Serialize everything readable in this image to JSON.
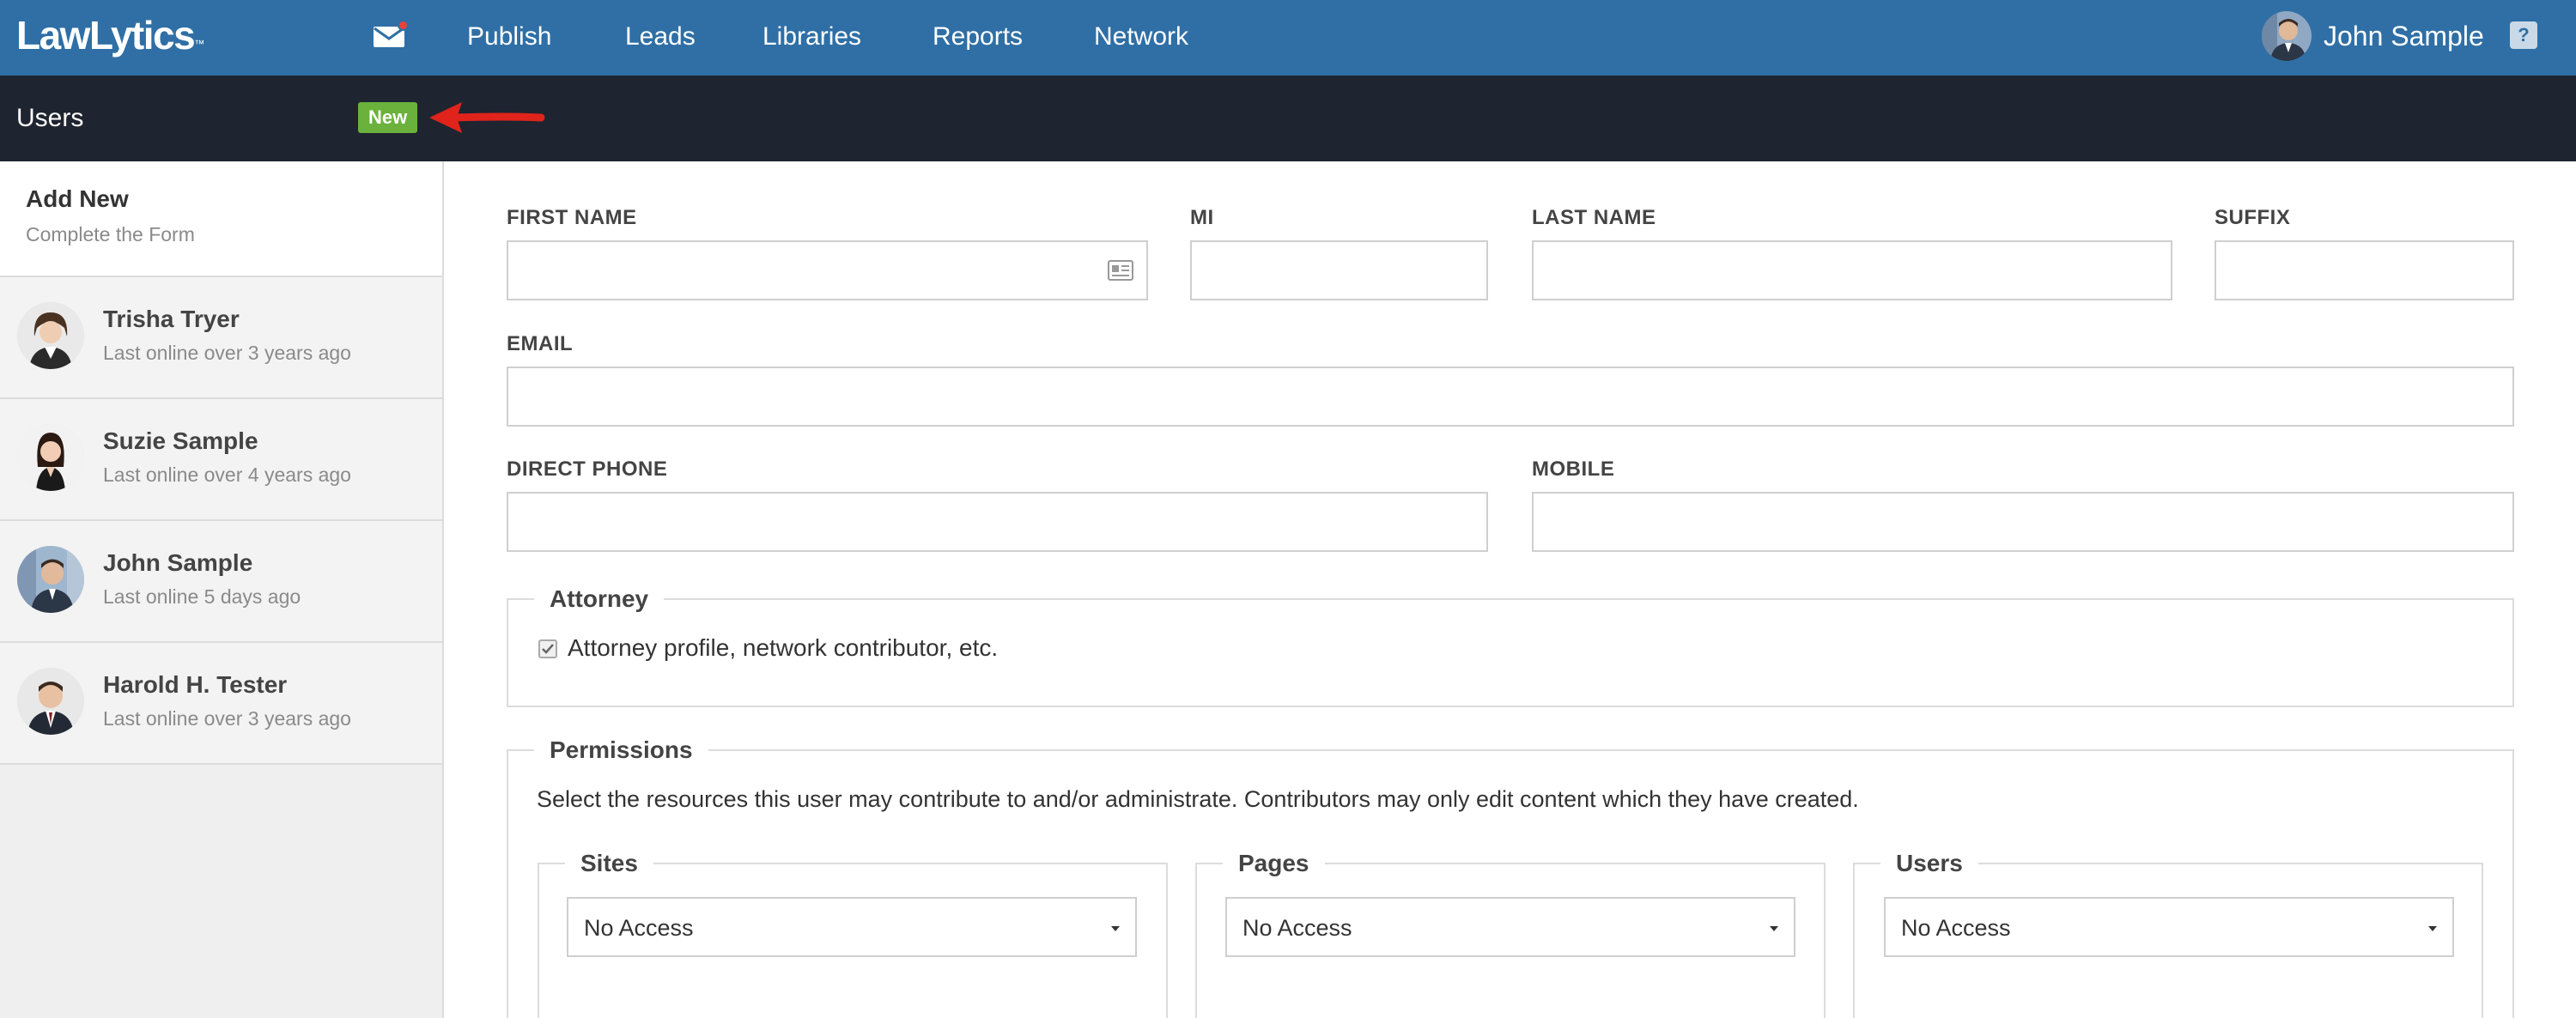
{
  "app": {
    "logo": "LawLytics",
    "logo_mark": "™"
  },
  "nav": {
    "items": [
      "Publish",
      "Leads",
      "Libraries",
      "Reports",
      "Network"
    ],
    "user_name": "John Sample",
    "help_label": "?"
  },
  "subbar": {
    "title": "Users",
    "new_badge": "New",
    "arrow_color": "#e0231b"
  },
  "sidebar": {
    "add_new": {
      "title": "Add New",
      "subtitle": "Complete the Form"
    },
    "users": [
      {
        "name": "Trisha Tryer",
        "status": "Last online over 3 years ago"
      },
      {
        "name": "Suzie Sample",
        "status": "Last online over 4 years ago"
      },
      {
        "name": "John Sample",
        "status": "Last online 5 days ago"
      },
      {
        "name": "Harold H. Tester",
        "status": "Last online over 3 years ago"
      }
    ]
  },
  "form": {
    "first_name_label": "FIRST NAME",
    "mi_label": "MI",
    "last_name_label": "LAST NAME",
    "suffix_label": "SUFFIX",
    "email_label": "EMAIL",
    "direct_phone_label": "DIRECT PHONE",
    "mobile_label": "MOBILE",
    "values": {
      "first_name": "",
      "mi": "",
      "last_name": "",
      "suffix": "",
      "email": "",
      "direct_phone": "",
      "mobile": ""
    }
  },
  "attorney": {
    "legend": "Attorney",
    "checkbox_label": "Attorney profile, network contributor, etc.",
    "checked": true
  },
  "permissions": {
    "legend": "Permissions",
    "description": "Select the resources this user may contribute to and/or administrate. Contributors may only edit content which they have created.",
    "groups": [
      {
        "legend": "Sites",
        "selected": "No Access"
      },
      {
        "legend": "Pages",
        "selected": "No Access"
      },
      {
        "legend": "Users",
        "selected": "No Access"
      }
    ]
  },
  "colors": {
    "nav_bg": "#2f6fa5",
    "subbar_bg": "#1e2430",
    "badge_green": "#6ab23c"
  }
}
